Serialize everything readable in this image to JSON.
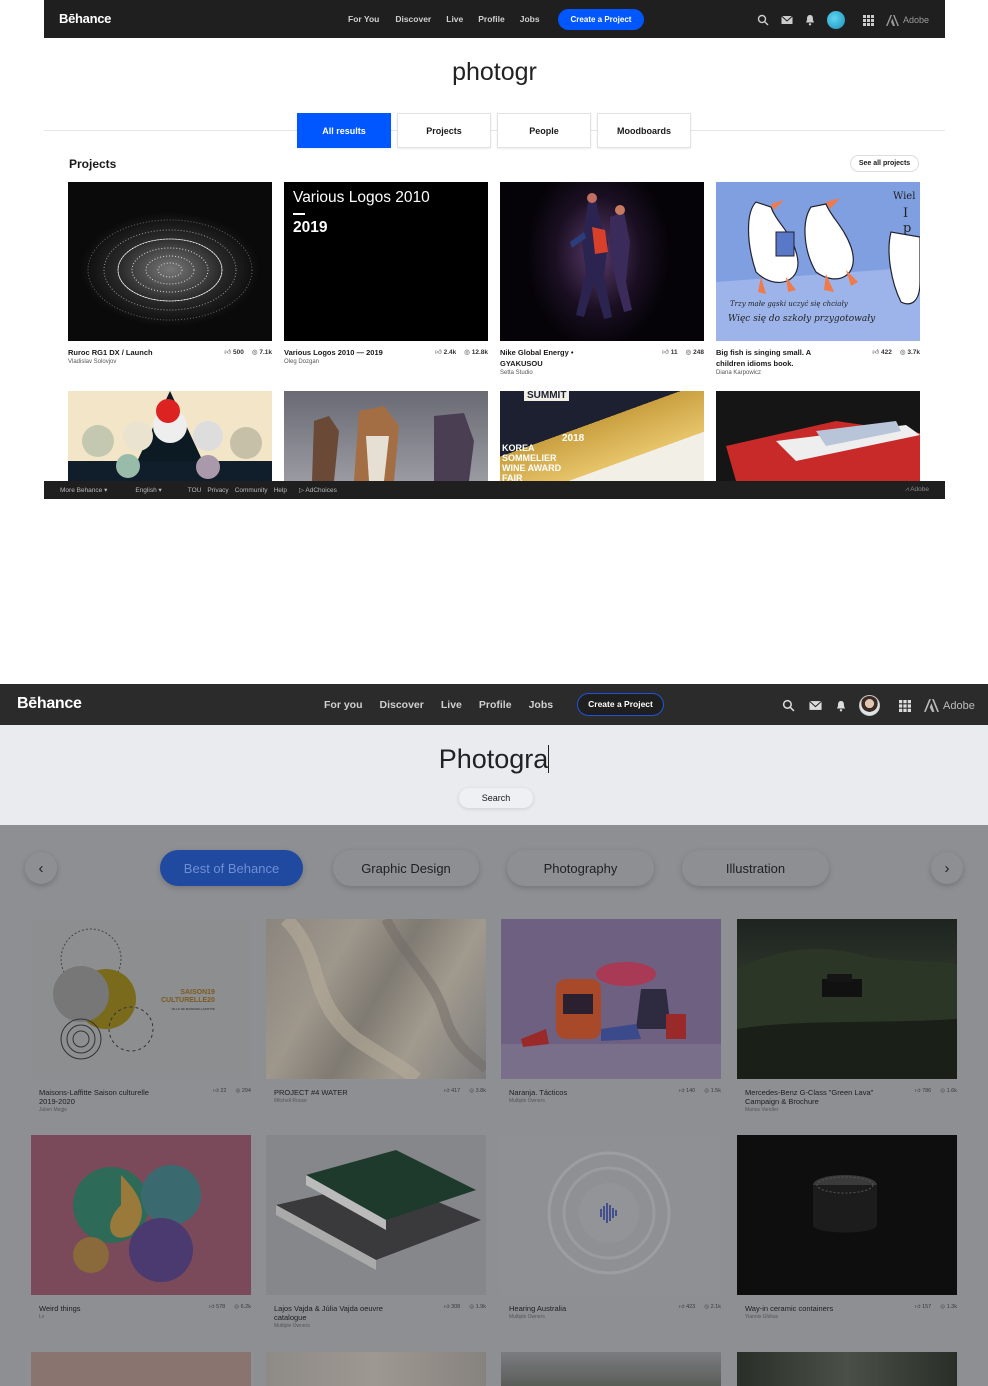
{
  "top": {
    "nav": {
      "logo": "Bēhance",
      "links": [
        "For You",
        "Discover",
        "Live",
        "Profile",
        "Jobs"
      ],
      "cta": "Create a Project",
      "adobe": "Adobe"
    },
    "search_query": "photogr",
    "tabs": [
      "All results",
      "Projects",
      "People",
      "Moodboards"
    ],
    "section_title": "Projects",
    "see_all": "See all projects",
    "projects": [
      {
        "title": "Ruroc RG1 DX / Launch",
        "owner": "Vladislav Solovjov",
        "likes": "500",
        "views": "7.1k"
      },
      {
        "title": "Various Logos 2010 — 2019",
        "owner": "Oleg Dozgan",
        "likes": "2.4k",
        "views": "12.8k"
      },
      {
        "title": "Nike Global Energy • GYAKUSOU",
        "owner": "Setta Studio",
        "likes": "11",
        "views": "248"
      },
      {
        "title": "Big fish is singing small. A children idioms book.",
        "owner": "Diana Karpowicz",
        "likes": "422",
        "views": "3.7k"
      }
    ],
    "thumb_text": {
      "logos_line1": "Various Logos 2010",
      "logos_line2": "2019",
      "book_1": "Wiel",
      "book_2": "I p",
      "book_3": "Trzy małe gąski uczyć się chciały",
      "book_4": "Więc się do szkoły przygotowały",
      "wine_1": "SUMMIT",
      "wine_2": "2018",
      "wine_3": "KOREA",
      "wine_4": "SOMMELIER",
      "wine_5": "WINE AWARD",
      "wine_6": "FAIR"
    },
    "footer": {
      "more": "More Behance",
      "lang": "English",
      "links": [
        "TOU",
        "Privacy",
        "Community",
        "Help"
      ],
      "adchoices": "AdChoices",
      "adobe": "Adobe"
    }
  },
  "bottom": {
    "nav": {
      "logo": "Bēhance",
      "links": [
        "For you",
        "Discover",
        "Live",
        "Profile",
        "Jobs"
      ],
      "cta": "Create a Project",
      "adobe": "Adobe"
    },
    "search_query": "Photogra",
    "search_button": "Search",
    "categories": [
      "Best of Behance",
      "Graphic Design",
      "Photography",
      "Illustration"
    ],
    "thumb_text": {
      "saison_1": "SAISON19",
      "saison_2": "CULTURELLE20",
      "saison_3": "VILLE DE MAISONS-LAFFITTE"
    },
    "projects": [
      {
        "title": "Maisons-Laffitte Saison culturelle 2019-2020",
        "owner": "Julien Megje",
        "likes": "22",
        "views": "294"
      },
      {
        "title": "PROJECT #4 WATER",
        "owner": "Mitchell Rouse",
        "likes": "417",
        "views": "3.8k"
      },
      {
        "title": "Naranja. Tácticos",
        "owner": "Multiple Owners",
        "likes": "140",
        "views": "1.5k"
      },
      {
        "title": "Mercedes-Benz G-Class \"Green Lava\" Campaign & Brochure",
        "owner": "Marius Vendler",
        "likes": "786",
        "views": "1.6k"
      },
      {
        "title": "Weird things",
        "owner": "Lv",
        "likes": "578",
        "views": "6.2k"
      },
      {
        "title": "Lajos Vajda & Júlia Vajda oeuvre catalogue",
        "owner": "Multiple Owners",
        "likes": "308",
        "views": "1.9k"
      },
      {
        "title": "Hearing Australia",
        "owner": "Multiple Owners",
        "likes": "423",
        "views": "2.1k"
      },
      {
        "title": "Way-in ceramic containers",
        "owner": "Yiannis Ghikas",
        "likes": "157",
        "views": "1.3k"
      }
    ]
  }
}
